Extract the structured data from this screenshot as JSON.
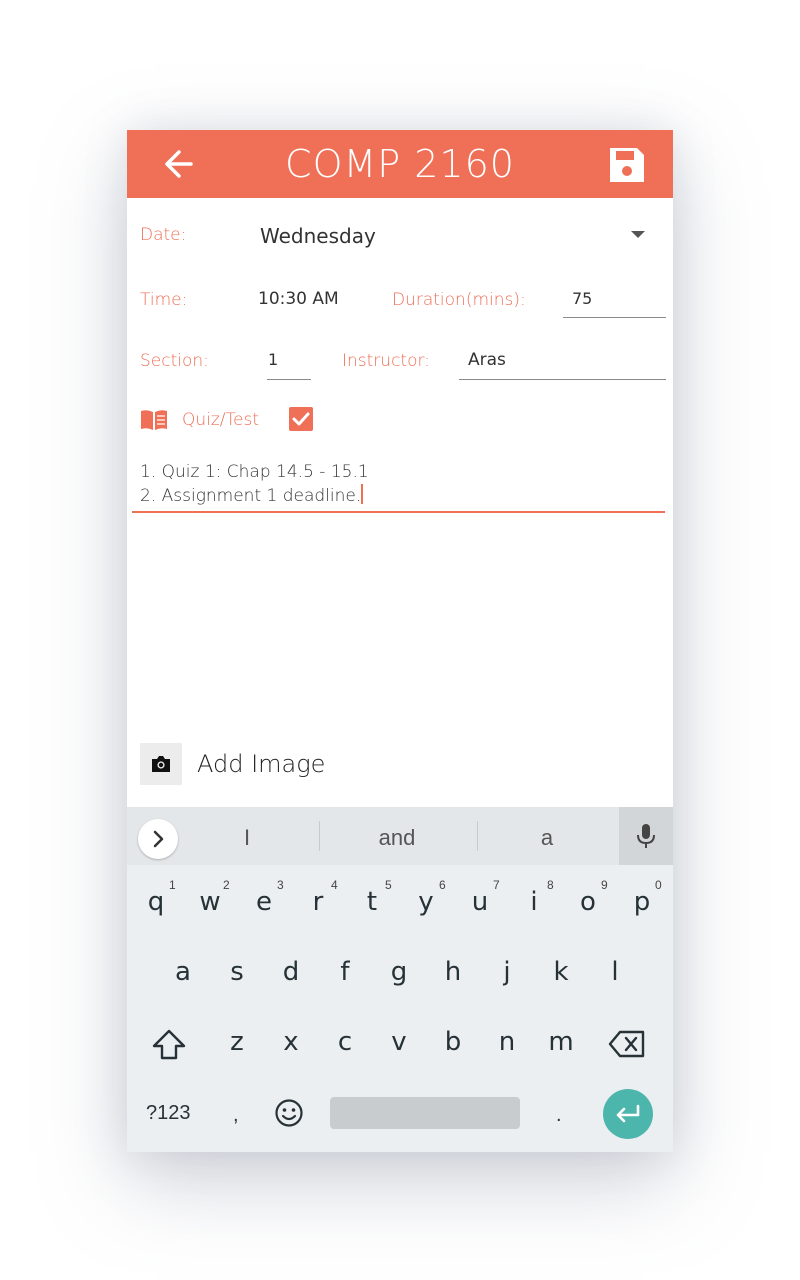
{
  "app": {
    "title": "COMP 2160",
    "accent_color": "#ef6f57",
    "back_icon": "arrow-left-icon",
    "save_icon": "floppy-save-icon"
  },
  "form": {
    "date_label": "Date:",
    "date_value": "Wednesday",
    "time_label": "Time:",
    "time_value": "10:30 AM",
    "duration_label": "Duration(mins):",
    "duration_value": "75",
    "section_label": "Section:",
    "section_value": "1",
    "instructor_label": "Instructor:",
    "instructor_value": "Aras",
    "quiz_label": "Quiz/Test",
    "quiz_checked": true,
    "notes_lines": [
      "1. Quiz 1: Chap 14.5 - 15.1",
      "2. Assignment 1 deadline."
    ],
    "add_image_label": "Add Image"
  },
  "keyboard": {
    "suggestions": [
      "I",
      "and",
      "a"
    ],
    "row1": [
      "q",
      "w",
      "e",
      "r",
      "t",
      "y",
      "u",
      "i",
      "o",
      "p"
    ],
    "row1_hints": [
      "1",
      "2",
      "3",
      "4",
      "5",
      "6",
      "7",
      "8",
      "9",
      "0"
    ],
    "row2": [
      "a",
      "s",
      "d",
      "f",
      "g",
      "h",
      "j",
      "k",
      "l"
    ],
    "row3": [
      "z",
      "x",
      "c",
      "v",
      "b",
      "n",
      "m"
    ],
    "symbols_label": "?123",
    "comma": ",",
    "period": ".",
    "enter_color": "#4db6ac"
  }
}
